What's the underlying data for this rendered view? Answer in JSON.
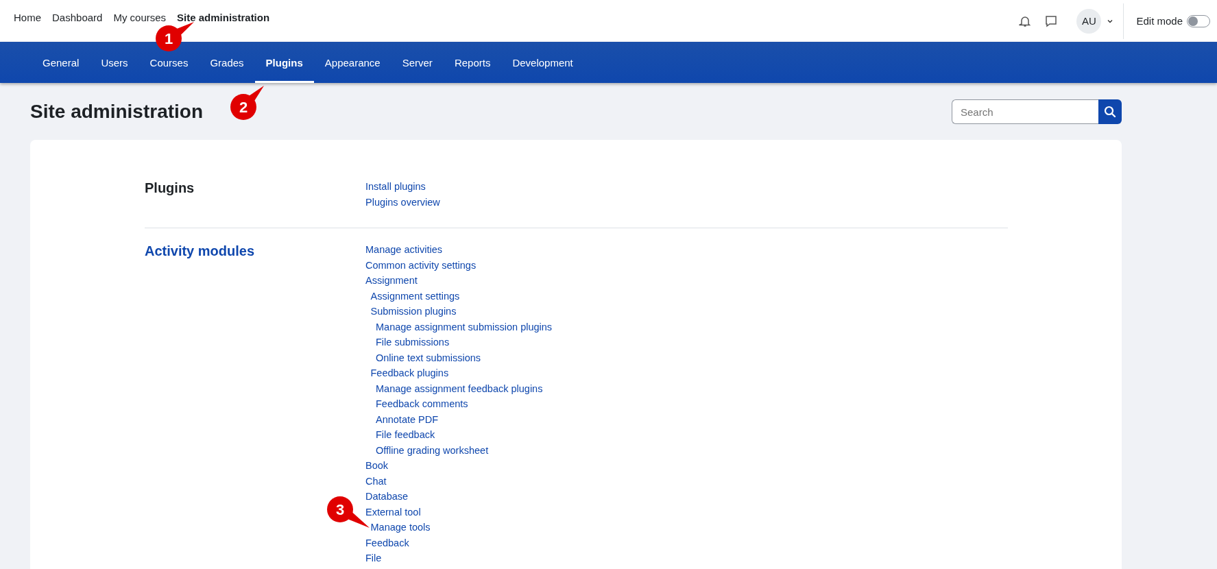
{
  "top_nav": [
    {
      "label": "Home",
      "selected": false
    },
    {
      "label": "Dashboard",
      "selected": false
    },
    {
      "label": "My courses",
      "selected": false
    },
    {
      "label": "Site administration",
      "selected": true
    }
  ],
  "user": {
    "initials": "AU"
  },
  "edit_mode": {
    "label": "Edit mode",
    "on": false
  },
  "tabs": [
    {
      "label": "General",
      "selected": false
    },
    {
      "label": "Users",
      "selected": false
    },
    {
      "label": "Courses",
      "selected": false
    },
    {
      "label": "Grades",
      "selected": false
    },
    {
      "label": "Plugins",
      "selected": true
    },
    {
      "label": "Appearance",
      "selected": false
    },
    {
      "label": "Server",
      "selected": false
    },
    {
      "label": "Reports",
      "selected": false
    },
    {
      "label": "Development",
      "selected": false
    }
  ],
  "page_title": "Site administration",
  "search": {
    "placeholder": "Search"
  },
  "sections": [
    {
      "heading": "Plugins",
      "link": false,
      "items": [
        {
          "label": "Install plugins"
        },
        {
          "label": "Plugins overview"
        }
      ]
    },
    {
      "heading": "Activity modules",
      "link": true,
      "items": [
        {
          "label": "Manage activities"
        },
        {
          "label": "Common activity settings"
        },
        {
          "label": "Assignment",
          "children": [
            {
              "label": "Assignment settings"
            },
            {
              "label": "Submission plugins",
              "children": [
                {
                  "label": "Manage assignment submission plugins"
                },
                {
                  "label": "File submissions"
                },
                {
                  "label": "Online text submissions"
                }
              ]
            },
            {
              "label": "Feedback plugins",
              "children": [
                {
                  "label": "Manage assignment feedback plugins"
                },
                {
                  "label": "Feedback comments"
                },
                {
                  "label": "Annotate PDF"
                },
                {
                  "label": "File feedback"
                },
                {
                  "label": "Offline grading worksheet"
                }
              ]
            }
          ]
        },
        {
          "label": "Book"
        },
        {
          "label": "Chat"
        },
        {
          "label": "Database"
        },
        {
          "label": "External tool",
          "children": [
            {
              "label": "Manage tools"
            }
          ]
        },
        {
          "label": "Feedback"
        },
        {
          "label": "File"
        }
      ]
    }
  ],
  "callouts": [
    "1",
    "2",
    "3"
  ]
}
